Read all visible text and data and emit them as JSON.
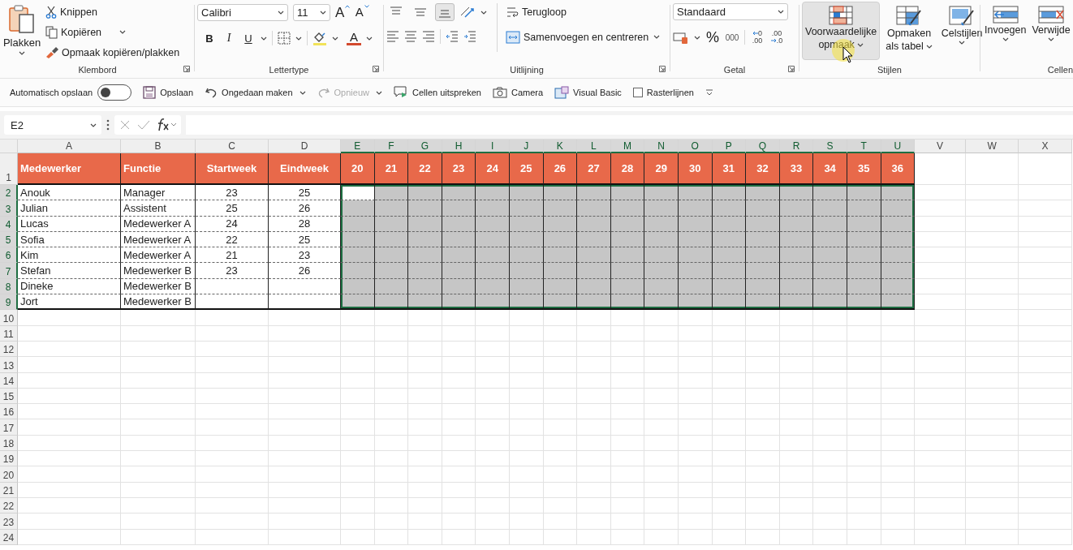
{
  "ribbon": {
    "clipboard": {
      "label": "Klembord",
      "paste": "Plakken",
      "cut": "Knippen",
      "copy": "Kopiëren",
      "format_painter": "Opmaak kopiëren/plakken"
    },
    "font": {
      "label": "Lettertype",
      "font_name": "Calibri",
      "font_size": "11",
      "grow": "A",
      "shrink": "A",
      "bold": "B",
      "italic": "I",
      "underline": "U",
      "font_color": "A"
    },
    "alignment": {
      "label": "Uitlijning",
      "vertical": [
        {
          "selected": false
        },
        {
          "selected": false
        },
        {
          "selected": true
        }
      ],
      "wrap": "Terugloop",
      "merge": "Samenvoegen en centreren"
    },
    "number": {
      "label": "Getal",
      "format": "Standaard",
      "percent": "%",
      "thousands": "000",
      "increase_decimal": [
        "0",
        ".00"
      ],
      "decrease_decimal": [
        ".00",
        ".0"
      ]
    },
    "styles": {
      "label": "Stijlen",
      "buttons": [
        {
          "lines": [
            "Voorwaardelijke",
            "opmaak"
          ],
          "hovered": true,
          "kind": "conditional"
        },
        {
          "lines": [
            "Opmaken",
            "als tabel"
          ],
          "hovered": false,
          "kind": "table"
        },
        {
          "lines": [
            "Celstijlen"
          ],
          "hovered": false,
          "kind": "cellstyle"
        }
      ]
    },
    "cells": {
      "label": "Cellen",
      "buttons": [
        {
          "label": "Invoegen",
          "kind": "insert"
        },
        {
          "label": "Verwijde",
          "kind": "delete"
        }
      ]
    }
  },
  "quick_access": {
    "autosave": {
      "label": "Automatisch opslaan",
      "on": false
    },
    "items": [
      {
        "label": "Opslaan",
        "kind": "save",
        "disabled": false
      },
      {
        "label": "Ongedaan maken",
        "kind": "undo",
        "disabled": false
      },
      {
        "label": "Opnieuw",
        "kind": "redo",
        "disabled": true
      },
      {
        "label": "Cellen uitspreken",
        "kind": "speak",
        "disabled": false
      },
      {
        "label": "Camera",
        "kind": "camera",
        "disabled": false
      },
      {
        "label": "Visual Basic",
        "kind": "vb",
        "disabled": false
      }
    ],
    "gridlines": {
      "label": "Rasterlijnen",
      "checked": false
    }
  },
  "name_box": {
    "value": "E2"
  },
  "columns": [
    {
      "label": "A",
      "selected": false
    },
    {
      "label": "B",
      "selected": false
    },
    {
      "label": "C",
      "selected": false
    },
    {
      "label": "D",
      "selected": false
    },
    {
      "label": "E",
      "selected": true
    },
    {
      "label": "F",
      "selected": true
    },
    {
      "label": "G",
      "selected": true
    },
    {
      "label": "H",
      "selected": true
    },
    {
      "label": "I",
      "selected": true
    },
    {
      "label": "J",
      "selected": true
    },
    {
      "label": "K",
      "selected": true
    },
    {
      "label": "L",
      "selected": true
    },
    {
      "label": "M",
      "selected": true
    },
    {
      "label": "N",
      "selected": true
    },
    {
      "label": "O",
      "selected": true
    },
    {
      "label": "P",
      "selected": true
    },
    {
      "label": "Q",
      "selected": true
    },
    {
      "label": "R",
      "selected": true
    },
    {
      "label": "S",
      "selected": true
    },
    {
      "label": "T",
      "selected": true
    },
    {
      "label": "U",
      "selected": true
    },
    {
      "label": "V",
      "selected": false
    },
    {
      "label": "W",
      "selected": false
    },
    {
      "label": "X",
      "selected": false
    }
  ],
  "rows": [
    {
      "label": "1",
      "selected": false,
      "kind": "header",
      "cells": [
        "Medewerker",
        "Functie",
        "Startweek",
        "Eindweek",
        "20",
        "21",
        "22",
        "23",
        "24",
        "25",
        "26",
        "27",
        "28",
        "29",
        "30",
        "31",
        "32",
        "33",
        "34",
        "35",
        "36"
      ]
    },
    {
      "label": "2",
      "selected": true,
      "kind": "data",
      "cells": [
        "Anouk",
        "Manager",
        "23",
        "25"
      ]
    },
    {
      "label": "3",
      "selected": true,
      "kind": "data",
      "cells": [
        "Julian",
        "Assistent",
        "25",
        "26"
      ]
    },
    {
      "label": "4",
      "selected": true,
      "kind": "data",
      "cells": [
        "Lucas",
        "Medewerker A",
        "24",
        "28"
      ]
    },
    {
      "label": "5",
      "selected": true,
      "kind": "data",
      "cells": [
        "Sofia",
        "Medewerker A",
        "22",
        "25"
      ]
    },
    {
      "label": "6",
      "selected": true,
      "kind": "data",
      "cells": [
        "Kim",
        "Medewerker A",
        "21",
        "23"
      ]
    },
    {
      "label": "7",
      "selected": true,
      "kind": "data",
      "cells": [
        "Stefan",
        "Medewerker B",
        "23",
        "26"
      ]
    },
    {
      "label": "8",
      "selected": true,
      "kind": "data",
      "cells": [
        "Dineke",
        "Medewerker B"
      ]
    },
    {
      "label": "9",
      "selected": true,
      "kind": "data",
      "cells": [
        "Jort",
        "Medewerker B"
      ]
    },
    {
      "label": "10",
      "selected": false,
      "kind": "empty"
    },
    {
      "label": "11",
      "selected": false,
      "kind": "empty"
    },
    {
      "label": "12",
      "selected": false,
      "kind": "empty"
    },
    {
      "label": "13",
      "selected": false,
      "kind": "empty"
    },
    {
      "label": "14",
      "selected": false,
      "kind": "empty"
    },
    {
      "label": "15",
      "selected": false,
      "kind": "empty"
    },
    {
      "label": "16",
      "selected": false,
      "kind": "empty"
    },
    {
      "label": "17",
      "selected": false,
      "kind": "empty"
    },
    {
      "label": "18",
      "selected": false,
      "kind": "empty"
    },
    {
      "label": "19",
      "selected": false,
      "kind": "empty"
    },
    {
      "label": "20",
      "selected": false,
      "kind": "empty"
    },
    {
      "label": "21",
      "selected": false,
      "kind": "empty"
    },
    {
      "label": "22",
      "selected": false,
      "kind": "empty"
    },
    {
      "label": "23",
      "selected": false,
      "kind": "empty"
    },
    {
      "label": "24",
      "selected": false,
      "kind": "empty"
    }
  ]
}
